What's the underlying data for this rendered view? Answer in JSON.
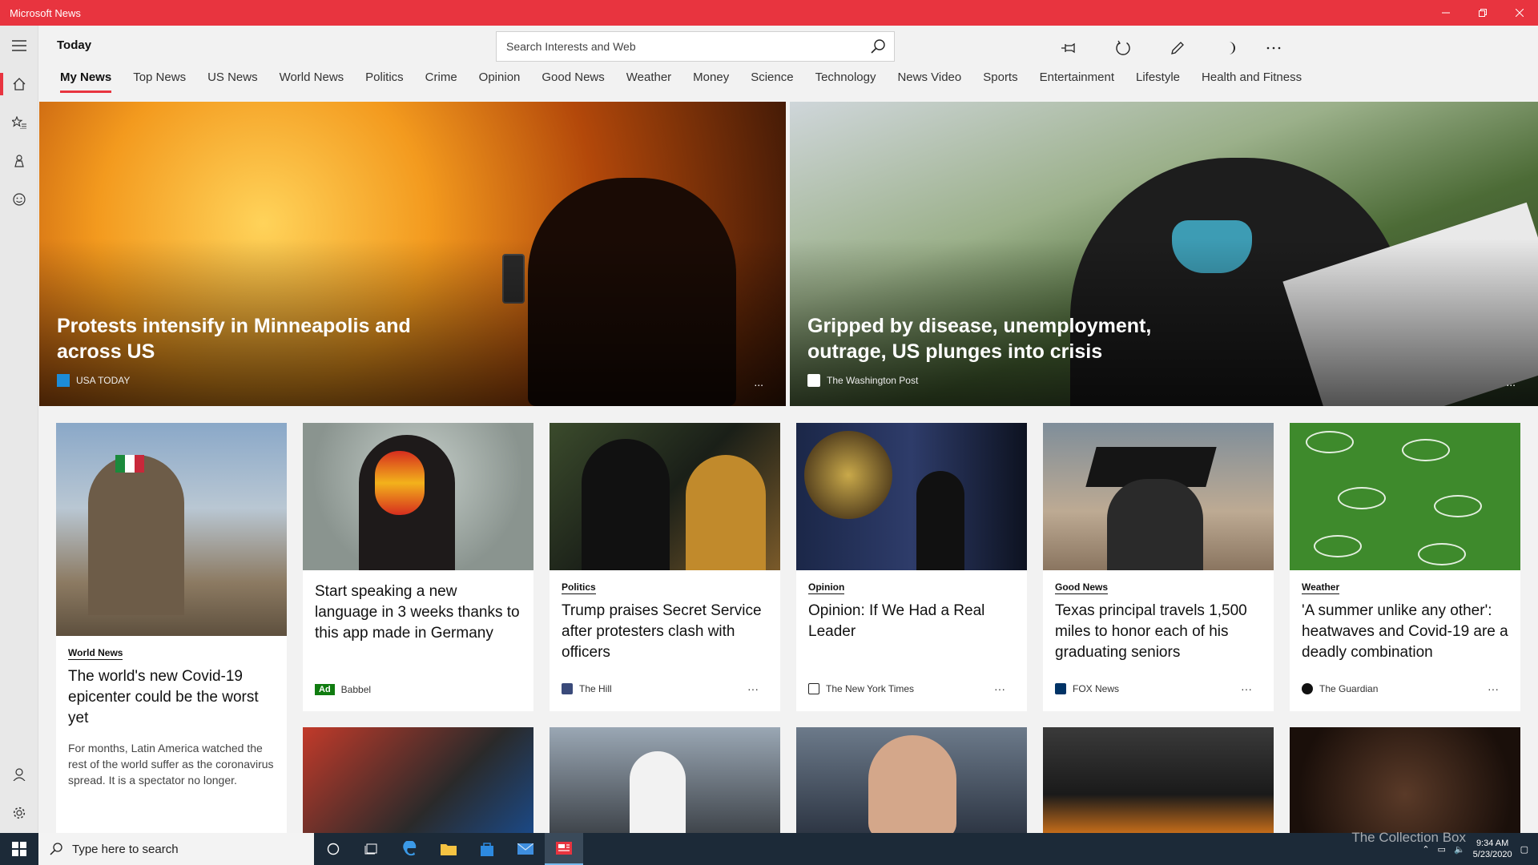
{
  "window": {
    "title": "Microsoft News"
  },
  "header": {
    "title": "Today",
    "search_placeholder": "Search Interests and Web"
  },
  "tabs": [
    {
      "label": "My News"
    },
    {
      "label": "Top News"
    },
    {
      "label": "US News"
    },
    {
      "label": "World News"
    },
    {
      "label": "Politics"
    },
    {
      "label": "Crime"
    },
    {
      "label": "Opinion"
    },
    {
      "label": "Good News"
    },
    {
      "label": "Weather"
    },
    {
      "label": "Money"
    },
    {
      "label": "Science"
    },
    {
      "label": "Technology"
    },
    {
      "label": "News Video"
    },
    {
      "label": "Sports"
    },
    {
      "label": "Entertainment"
    },
    {
      "label": "Lifestyle"
    },
    {
      "label": "Health and Fitness"
    }
  ],
  "hero": [
    {
      "title": "Protests intensify in Minneapolis and across US",
      "source": "USA TODAY",
      "more": "..."
    },
    {
      "title": "Gripped by disease, unemployment, outrage, US plunges into crisis",
      "source": "The Washington Post",
      "more": "..."
    }
  ],
  "cards": [
    {
      "tag": "World News",
      "title": "The world's new Covid-19 epicenter could be the worst yet",
      "summary": "For months, Latin America watched the rest of the world suffer as the coronavirus spread. It is a spectator no longer."
    },
    {
      "title": "Start speaking a new language in 3 weeks thanks to this app made in Germany",
      "ad": "Ad",
      "source": "Babbel"
    },
    {
      "tag": "Politics",
      "title": "Trump praises Secret Service after protesters clash with officers",
      "source": "The Hill",
      "more": "···"
    },
    {
      "tag": "Opinion",
      "title": "Opinion: If We Had a Real Leader",
      "source": "The New York Times",
      "more": "···"
    },
    {
      "tag": "Good News",
      "title": "Texas principal travels 1,500 miles to honor each of his graduating seniors",
      "source": "FOX News",
      "more": "···"
    },
    {
      "tag": "Weather",
      "title": "'A summer unlike any other': heatwaves and Covid-19 are a deadly combination",
      "source": "The Guardian",
      "more": "···"
    }
  ],
  "taskbar": {
    "search_placeholder": "Type here to search",
    "time": "9:34 AM",
    "date": "5/23/2020"
  },
  "watermark": "The Collection Box",
  "colors": {
    "accent": "#e8343f",
    "taskbar": "#1c2a38",
    "ad": "#107c10"
  }
}
